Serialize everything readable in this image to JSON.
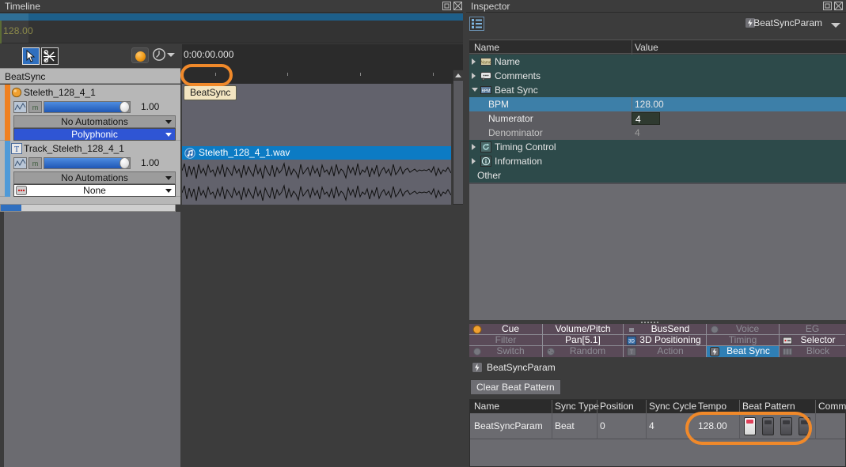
{
  "timeline": {
    "title": "Timeline",
    "window_buttons": [
      "restore-icon",
      "close-icon"
    ],
    "ruler_bpm": "128.00",
    "timecode": "0:00:00.000",
    "tools": [
      {
        "name": "select-tool",
        "icon": "cursor-arrow-icon",
        "selected": true
      },
      {
        "name": "cut-tool",
        "icon": "scissors-icon",
        "selected": false
      }
    ],
    "record_button": "record-icon",
    "clock_button": "clock-icon",
    "track_header_label": "BeatSync",
    "clip_badge": "BeatSync",
    "clip": {
      "name": "Steleth_128_4_1.wav",
      "icon": "audio-note-icon"
    },
    "tracks": [
      {
        "name": "Steleth_128_4_1",
        "icon": "sound-object-icon",
        "color": "#f08020",
        "volume": "1.00",
        "automation": "No Automations",
        "mode": "Polyphonic",
        "mode_style": "blue"
      },
      {
        "name": "Track_Steleth_128_4_1",
        "icon": "track-object-icon",
        "color": "#4f9ad8",
        "volume": "1.00",
        "automation": "No Automations",
        "mode": "None",
        "mode_style": "white"
      }
    ]
  },
  "inspector": {
    "title": "Inspector",
    "window_buttons": [
      "restore-icon",
      "close-icon"
    ],
    "list_button": "list-view-icon",
    "object_name": "BeatSyncParam",
    "object_icon": "beat-sync-icon",
    "columns": {
      "name": "Name",
      "value": "Value"
    },
    "properties": [
      {
        "label": "Name",
        "icon": "name-icon",
        "type": "group",
        "twisty": "closed",
        "value": "",
        "selected": false
      },
      {
        "label": "Comments",
        "icon": "comments-icon",
        "type": "group",
        "twisty": "closed",
        "value": "",
        "selected": false
      },
      {
        "label": "Beat Sync",
        "icon": "bpm-icon",
        "type": "group",
        "twisty": "open",
        "value": "",
        "selected": false
      },
      {
        "label": "BPM",
        "icon": "",
        "type": "sub",
        "twisty": "",
        "value": "128.00",
        "selected": true
      },
      {
        "label": "Numerator",
        "icon": "",
        "type": "sub",
        "twisty": "",
        "value": "4",
        "selected": false,
        "editable": true
      },
      {
        "label": "Denominator",
        "icon": "",
        "type": "sub",
        "twisty": "",
        "value": "4",
        "selected": false,
        "dim": true
      },
      {
        "label": "Timing Control",
        "icon": "timing-icon",
        "type": "group",
        "twisty": "closed",
        "value": "",
        "selected": false
      },
      {
        "label": "Information",
        "icon": "info-icon",
        "type": "group",
        "twisty": "closed",
        "value": "",
        "selected": false
      },
      {
        "label": "Other",
        "icon": "",
        "type": "other",
        "twisty": "",
        "value": "",
        "selected": false
      }
    ],
    "tabs": [
      {
        "label": "Cue",
        "icon": "cue-icon",
        "enabled": true,
        "selected": false
      },
      {
        "label": "Volume/Pitch",
        "icon": "",
        "enabled": true,
        "selected": false
      },
      {
        "label": "BusSend",
        "icon": "bussend-icon",
        "enabled": true,
        "selected": false
      },
      {
        "label": "Voice",
        "icon": "voice-icon",
        "enabled": false,
        "selected": false
      },
      {
        "label": "EG",
        "icon": "",
        "enabled": false,
        "selected": false
      },
      {
        "label": "Filter",
        "icon": "",
        "enabled": false,
        "selected": false
      },
      {
        "label": "Pan[5.1]",
        "icon": "",
        "enabled": true,
        "selected": false
      },
      {
        "label": "3D Positioning",
        "icon": "3d-icon",
        "enabled": true,
        "selected": false
      },
      {
        "label": "Timing",
        "icon": "",
        "enabled": false,
        "selected": false
      },
      {
        "label": "Selector",
        "icon": "selector-icon",
        "enabled": true,
        "selected": false
      },
      {
        "label": "Switch",
        "icon": "switch-icon",
        "enabled": false,
        "selected": false
      },
      {
        "label": "Random",
        "icon": "random-icon",
        "enabled": false,
        "selected": false
      },
      {
        "label": "Action",
        "icon": "action-icon",
        "enabled": false,
        "selected": false
      },
      {
        "label": "Beat Sync",
        "icon": "beat-sync-icon",
        "enabled": true,
        "selected": true
      },
      {
        "label": "Block",
        "icon": "block-icon",
        "enabled": false,
        "selected": false
      }
    ],
    "beat_sync": {
      "param_label": "BeatSyncParam",
      "param_icon": "beat-sync-icon",
      "clear_button": "Clear Beat Pattern",
      "table": {
        "headers": [
          "Name",
          "Sync Type",
          "Position",
          "Sync Cycle",
          "Tempo",
          "Beat Pattern",
          "Comm"
        ],
        "rows": [
          {
            "name": "BeatSyncParam",
            "sync_type": "Beat",
            "position": "0",
            "sync_cycle": "4",
            "tempo": "128.00",
            "beat_pattern": [
              true,
              false,
              false,
              false
            ],
            "comment": ""
          }
        ]
      }
    }
  },
  "highlights": {
    "color": "#f0892a",
    "regions": [
      "clip-badge-beatsync",
      "tempo-and-beat-pattern"
    ]
  }
}
